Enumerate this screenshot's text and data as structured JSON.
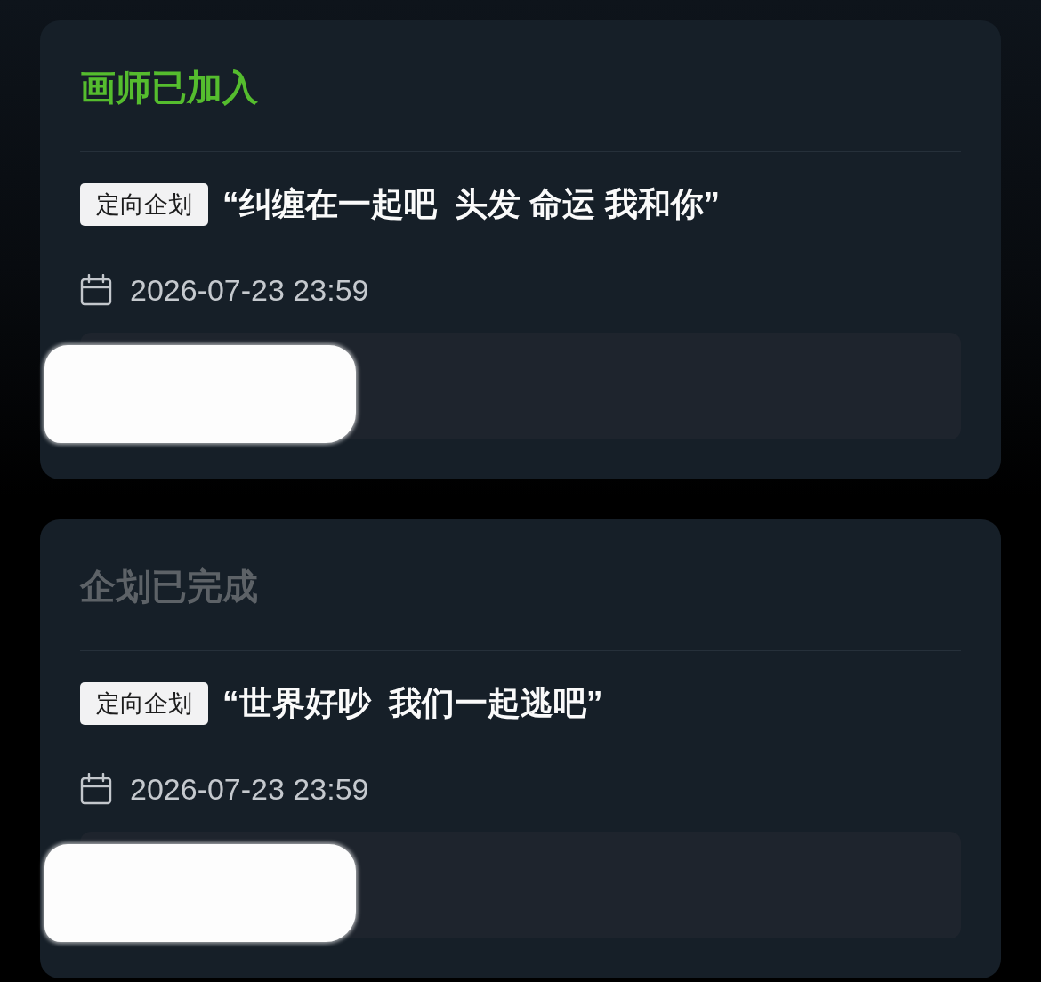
{
  "cards": [
    {
      "status": {
        "label": "画师已加入",
        "kind": "joined"
      },
      "tag": "定向企划",
      "title": "“纠缠在一起吧  头发 命运 我和你”",
      "deadline": "2026-07-23 23:59",
      "details": {
        "redacted": true
      }
    },
    {
      "status": {
        "label": "企划已完成",
        "kind": "done"
      },
      "tag": "定向企划",
      "title": "“世界好吵  我们一起逃吧”",
      "deadline": "2026-07-23 23:59",
      "details": {
        "redacted": true
      }
    }
  ]
}
